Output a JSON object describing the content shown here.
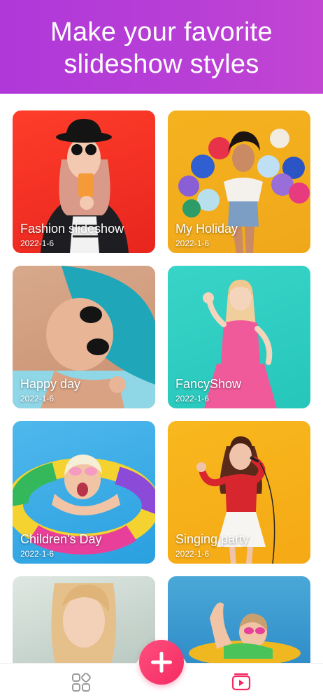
{
  "header": {
    "title_line1": "Make your favorite",
    "title_line2": "slideshow styles"
  },
  "cards": [
    {
      "title": "Fashion slideshow",
      "date": "2022-1-6"
    },
    {
      "title": "My Holiday",
      "date": "2022-1-6"
    },
    {
      "title": "Happy day",
      "date": "2022-1-6"
    },
    {
      "title": "FancyShow",
      "date": "2022-1-6"
    },
    {
      "title": "Children's Day",
      "date": "2022-1-6"
    },
    {
      "title": "Singing party",
      "date": "2022-1-6"
    }
  ],
  "bottom_nav": {
    "left_icon": "templates-grid-icon",
    "center_icon": "plus-icon",
    "right_icon": "video-icon",
    "accent": "#f42b63",
    "header_color": "#b83fd6"
  }
}
